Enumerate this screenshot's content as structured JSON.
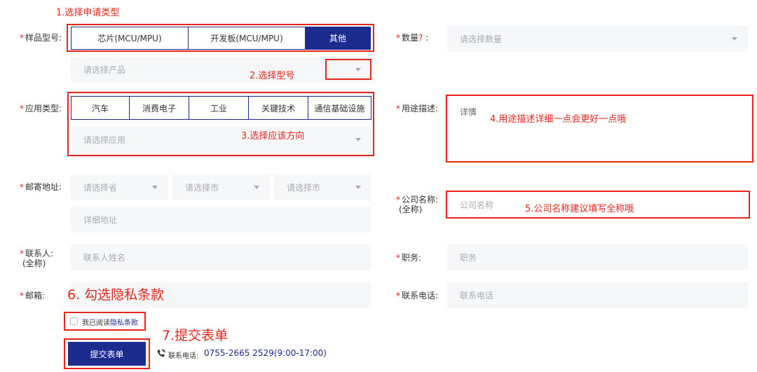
{
  "annotations": {
    "a1": "1.选择申请类型",
    "a2": "2.选择型号",
    "a3": "3.选择应该方向",
    "a4": "4.用途描述详细一点会更好一点哦",
    "a5": "5.公司名称建议填写全称哦",
    "a6": "6. 勾选隐私条款",
    "a7": "7.提交表单"
  },
  "sample_type": {
    "label": "样品型号:",
    "options": [
      "芯片(MCU/MPU)",
      "开发板(MCU/MPU)",
      "其他"
    ],
    "selected": "其他"
  },
  "product_select": {
    "placeholder": "请选择产品"
  },
  "quantity": {
    "label": "数量",
    "hint": "?",
    "colon": " :",
    "placeholder": "请选择数量"
  },
  "application": {
    "label": "应用类型:",
    "options": [
      "汽车",
      "消费电子",
      "工业",
      "关键技术",
      "通信基础设施"
    ],
    "placeholder": "请选择应用"
  },
  "usage": {
    "label": "用途描述:",
    "placeholder": "详情"
  },
  "address": {
    "label": "邮寄地址:",
    "province": "请选择省",
    "city": "请选择市",
    "district": "请选择市",
    "detail": "详细地址"
  },
  "company": {
    "label": "公司名称:",
    "label_sub": "(全称)",
    "placeholder": "公司名称"
  },
  "contact": {
    "label": "联系人:",
    "label_sub": "(全称)",
    "placeholder": "联系人姓名"
  },
  "position": {
    "label": "职务:",
    "placeholder": "职务"
  },
  "email": {
    "label": "邮箱:"
  },
  "phone": {
    "label": "联系电话:",
    "placeholder": "联系电话"
  },
  "privacy": {
    "text": "我已阅读",
    "link": "隐私条款"
  },
  "submit": {
    "label": "提交表单"
  },
  "hotline": {
    "label": "联系电话:",
    "number": "0755-2665 2529(9:00-17:00)"
  },
  "colors": {
    "accent": "#1d2a8e",
    "annotation": "#e8231b",
    "field_bg": "#f6f7f9",
    "required": "#e02020"
  }
}
